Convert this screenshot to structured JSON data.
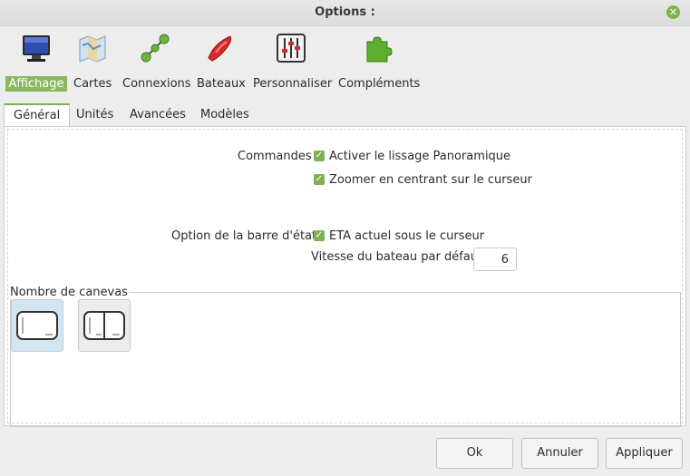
{
  "window": {
    "title": "Options :"
  },
  "categories": [
    {
      "label": "Affichage",
      "icon": "monitor-icon",
      "selected": true
    },
    {
      "label": "Cartes",
      "icon": "map-icon"
    },
    {
      "label": "Connexions",
      "icon": "connections-icon"
    },
    {
      "label": "Bateaux",
      "icon": "boat-icon"
    },
    {
      "label": "Personnaliser",
      "icon": "sliders-icon"
    },
    {
      "label": "Compléments",
      "icon": "puzzle-icon"
    }
  ],
  "tabs": [
    {
      "label": "Général",
      "active": true
    },
    {
      "label": "Unités"
    },
    {
      "label": "Avancées"
    },
    {
      "label": "Modèles"
    }
  ],
  "general": {
    "commandes_label": "Commandes",
    "chk_lissage": "Activer le lissage Panoramique",
    "chk_zoom": "Zoomer en centrant sur le curseur",
    "status_label": "Option de la barre d'état",
    "chk_eta": "ETA actuel sous le curseur",
    "speed_label": "Vitesse du bateau par défaut",
    "speed_value": "6",
    "canvas_label": "Nombre de canevas"
  },
  "buttons": {
    "ok": "Ok",
    "cancel": "Annuler",
    "apply": "Appliquer"
  },
  "colors": {
    "accent": "#7fb34f"
  }
}
